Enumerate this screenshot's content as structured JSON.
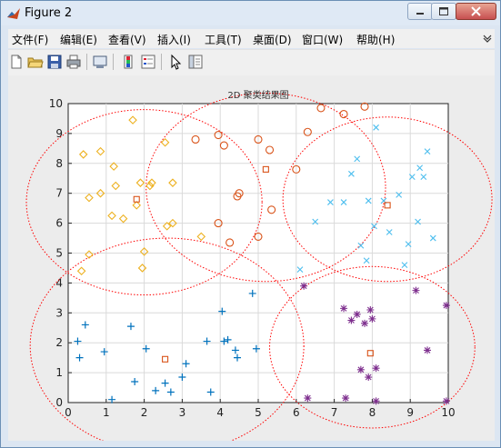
{
  "window": {
    "title": "Figure 2"
  },
  "menus": [
    "文件(F)",
    "编辑(E)",
    "查看(V)",
    "插入(I)",
    "工具(T)",
    "桌面(D)",
    "窗口(W)",
    "帮助(H)"
  ],
  "toolbar": [
    "new-figure-icon",
    "open-file-icon",
    "save-icon",
    "print-icon",
    "link-plot-icon",
    "colorbar-icon",
    "legend-icon",
    "select-arrow-icon",
    "property-editor-icon"
  ],
  "chart_data": {
    "type": "scatter",
    "title": "2D 聚类结果图",
    "xlabel": "",
    "ylabel": "",
    "xlim": [
      0,
      10
    ],
    "ylim": [
      0,
      10
    ],
    "xticks": [
      "0",
      "1",
      "2",
      "3",
      "4",
      "5",
      "6",
      "7",
      "8",
      "9",
      "10"
    ],
    "yticks": [
      "0",
      "1",
      "2",
      "3",
      "4",
      "5",
      "6",
      "7",
      "8",
      "9",
      "10"
    ],
    "grid": true,
    "series": [
      {
        "marker": "diamond",
        "color": "#EDB120",
        "points": [
          [
            0.35,
            4.4
          ],
          [
            0.55,
            4.95
          ],
          [
            0.4,
            8.3
          ],
          [
            0.55,
            6.85
          ],
          [
            0.85,
            8.4
          ],
          [
            0.85,
            7.0
          ],
          [
            1.15,
            6.25
          ],
          [
            1.25,
            7.25
          ],
          [
            1.2,
            7.9
          ],
          [
            1.45,
            6.15
          ],
          [
            1.7,
            9.45
          ],
          [
            1.8,
            6.6
          ],
          [
            1.9,
            7.35
          ],
          [
            1.95,
            4.5
          ],
          [
            2.0,
            5.05
          ],
          [
            2.15,
            7.25
          ],
          [
            2.2,
            7.35
          ],
          [
            2.55,
            8.7
          ],
          [
            2.6,
            5.9
          ],
          [
            2.75,
            6.0
          ],
          [
            2.75,
            7.35
          ],
          [
            3.5,
            5.55
          ]
        ]
      },
      {
        "marker": "circle",
        "color": "#D95319",
        "points": [
          [
            3.35,
            8.8
          ],
          [
            3.95,
            6.0
          ],
          [
            3.95,
            8.95
          ],
          [
            4.1,
            8.6
          ],
          [
            4.25,
            5.35
          ],
          [
            4.45,
            6.9
          ],
          [
            4.5,
            7.0
          ],
          [
            5.0,
            5.55
          ],
          [
            5.0,
            8.8
          ],
          [
            5.3,
            8.45
          ],
          [
            5.35,
            6.45
          ],
          [
            6.0,
            7.8
          ],
          [
            6.3,
            9.05
          ],
          [
            6.65,
            9.85
          ],
          [
            7.25,
            9.65
          ],
          [
            7.8,
            9.9
          ]
        ]
      },
      {
        "marker": "x",
        "color": "#4DBEEE",
        "points": [
          [
            6.1,
            4.45
          ],
          [
            6.5,
            6.05
          ],
          [
            6.9,
            6.7
          ],
          [
            7.25,
            6.7
          ],
          [
            7.45,
            7.65
          ],
          [
            7.6,
            8.15
          ],
          [
            7.7,
            5.25
          ],
          [
            7.85,
            4.75
          ],
          [
            7.9,
            6.75
          ],
          [
            8.05,
            5.9
          ],
          [
            8.1,
            9.2
          ],
          [
            8.3,
            6.75
          ],
          [
            8.45,
            5.7
          ],
          [
            8.7,
            6.95
          ],
          [
            8.85,
            4.6
          ],
          [
            8.95,
            5.3
          ],
          [
            9.05,
            7.55
          ],
          [
            9.2,
            6.05
          ],
          [
            9.25,
            7.85
          ],
          [
            9.35,
            7.55
          ],
          [
            9.45,
            8.4
          ],
          [
            9.6,
            5.5
          ]
        ]
      },
      {
        "marker": "plus",
        "color": "#0072BD",
        "points": [
          [
            0.25,
            2.05
          ],
          [
            0.3,
            1.5
          ],
          [
            0.45,
            2.6
          ],
          [
            0.95,
            1.7
          ],
          [
            1.15,
            0.1
          ],
          [
            1.65,
            2.55
          ],
          [
            1.75,
            0.7
          ],
          [
            2.05,
            1.8
          ],
          [
            2.3,
            0.4
          ],
          [
            2.55,
            0.65
          ],
          [
            2.7,
            0.35
          ],
          [
            3.0,
            0.85
          ],
          [
            3.1,
            1.3
          ],
          [
            3.65,
            2.05
          ],
          [
            3.75,
            0.35
          ],
          [
            4.05,
            3.05
          ],
          [
            4.1,
            2.05
          ],
          [
            4.2,
            2.1
          ],
          [
            4.4,
            1.75
          ],
          [
            4.45,
            1.5
          ],
          [
            4.85,
            3.65
          ],
          [
            4.95,
            1.8
          ]
        ]
      },
      {
        "marker": "star",
        "color": "#7E2F8E",
        "points": [
          [
            6.2,
            3.9
          ],
          [
            6.3,
            0.15
          ],
          [
            7.25,
            3.15
          ],
          [
            7.3,
            0.15
          ],
          [
            7.45,
            2.75
          ],
          [
            7.6,
            2.95
          ],
          [
            7.7,
            1.1
          ],
          [
            7.8,
            2.65
          ],
          [
            7.9,
            0.85
          ],
          [
            7.95,
            3.1
          ],
          [
            8.0,
            2.8
          ],
          [
            8.1,
            1.15
          ],
          [
            8.1,
            0.05
          ],
          [
            9.15,
            3.75
          ],
          [
            9.45,
            1.75
          ],
          [
            9.95,
            3.25
          ],
          [
            9.95,
            0.05
          ]
        ]
      }
    ],
    "centroids": {
      "marker": "square",
      "color": "#D95319",
      "points": [
        [
          1.8,
          6.8
        ],
        [
          5.2,
          7.8
        ],
        [
          8.4,
          6.6
        ],
        [
          2.55,
          1.45
        ],
        [
          7.95,
          1.65
        ]
      ]
    },
    "cluster_circles": {
      "color": "#FF0000",
      "style": "dotted",
      "circles": [
        {
          "center": [
            2.0,
            6.7
          ],
          "radius": 3.1
        },
        {
          "center": [
            5.2,
            7.2
          ],
          "radius": 3.15
        },
        {
          "center": [
            8.4,
            6.8
          ],
          "radius": 2.75
        },
        {
          "center": [
            2.6,
            1.9
          ],
          "radius": 3.6
        },
        {
          "center": [
            8.0,
            1.85
          ],
          "radius": 2.7
        }
      ]
    }
  }
}
